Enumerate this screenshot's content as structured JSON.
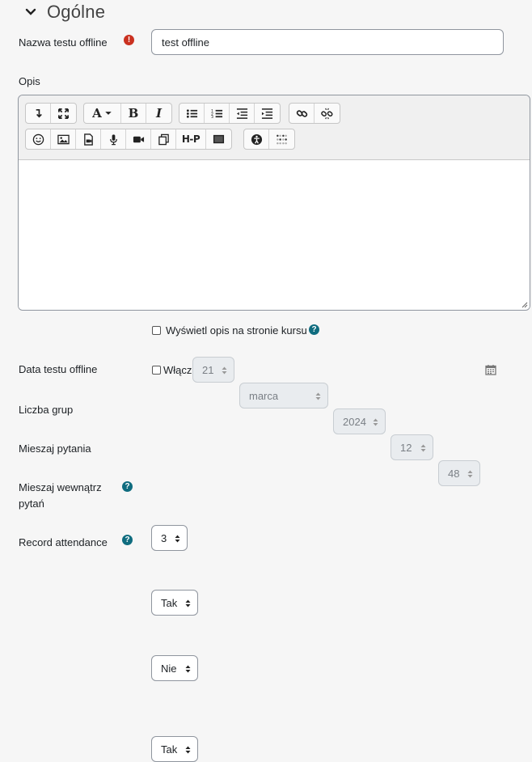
{
  "section": {
    "title": "Ogólne",
    "icon": "chevron-down-icon"
  },
  "fields": {
    "name": {
      "label": "Nazwa testu offline",
      "value": "test offline",
      "required_icon": "exclamation-icon"
    },
    "description": {
      "label": "Opis"
    },
    "show_description": {
      "label": "Wyświetl opis na stronie kursu",
      "checked": false,
      "help_icon": "question-icon"
    },
    "date": {
      "label": "Data testu offline",
      "enable_label": "Włącz",
      "enabled": false,
      "day": "21",
      "month": "marca",
      "year": "2024",
      "hour": "12",
      "minute": "48",
      "calendar_icon": "calendar-icon"
    },
    "groups": {
      "label": "Liczba grup",
      "value": "3"
    },
    "shuffle_questions": {
      "label": "Mieszaj pytania",
      "value": "Tak"
    },
    "shuffle_answers": {
      "label_line1": "Mieszaj wewnątrz",
      "label_line2": "pytań",
      "value": "Nie",
      "help_icon": "question-icon"
    },
    "record_attendance": {
      "label": "Record attendance",
      "value": "Tak",
      "help_icon": "question-icon"
    }
  },
  "toolbar": {
    "row1": [
      [
        "collapse-icon",
        "fullscreen-icon"
      ],
      [
        "font-color-icon",
        "bold-icon",
        "italic-icon"
      ],
      [
        "unordered-list-icon",
        "ordered-list-icon",
        "outdent-icon",
        "indent-icon"
      ],
      [
        "link-icon",
        "unlink-icon"
      ]
    ],
    "row2": [
      [
        "emoji-icon",
        "image-icon",
        "media-icon",
        "record-audio-icon",
        "record-video-icon",
        "manage-files-icon",
        "h5p-icon",
        "screen-icon"
      ],
      [
        "accessibility-checker-icon",
        "braille-icon"
      ]
    ],
    "labels": {
      "font": "A",
      "bold": "B",
      "italic": "I",
      "h5p": "H-P"
    }
  },
  "colors": {
    "required": "#ca3120",
    "help": "#0f6c7f",
    "border": "#8f959e"
  }
}
